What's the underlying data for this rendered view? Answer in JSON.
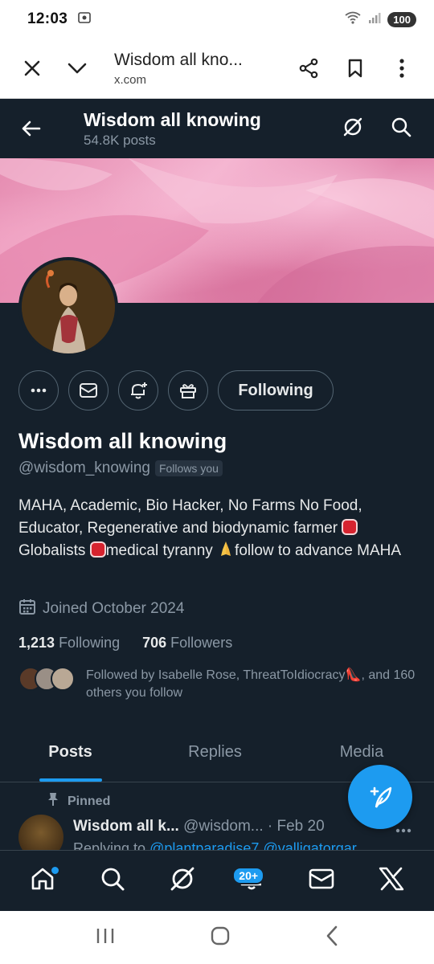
{
  "status_bar": {
    "time": "12:03",
    "battery": "100"
  },
  "browser": {
    "page_title": "Wisdom all kno...",
    "url": "x.com"
  },
  "header": {
    "name": "Wisdom all knowing",
    "posts": "54.8K posts"
  },
  "profile": {
    "name": "Wisdom all knowing",
    "handle": "@wisdom_knowing",
    "follows_you": "Follows you",
    "following_button": "Following",
    "bio_line1": "MAHA, Academic, Bio Hacker, No Farms No Food, Educator, Regenerative and biodynamic farmer",
    "bio_line2": "Globalists",
    "bio_line3": "medical tyranny",
    "bio_line4": "follow to advance MAHA",
    "joined": "Joined October 2024",
    "following_count": "1,213",
    "following_label": "Following",
    "followers_count": "706",
    "followers_label": "Followers",
    "followed_by": "Followed by Isabelle Rose, ThreatToIdiocracy👠, and 160 others you follow"
  },
  "tabs": [
    "Posts",
    "Replies",
    "Media"
  ],
  "pinned_post": {
    "pinned_label": "Pinned",
    "author": "Wisdom all k...",
    "handle": "@wisdom...",
    "date": "· Feb 20",
    "replying_prefix": "Replying to",
    "replying_to": "@plantparadise7 @valligatorgar"
  },
  "bottom_nav": {
    "notifications_badge": "20+"
  },
  "colors": {
    "background": "#15202b",
    "accent": "#1d9bf0",
    "muted": "#8b98a5"
  }
}
